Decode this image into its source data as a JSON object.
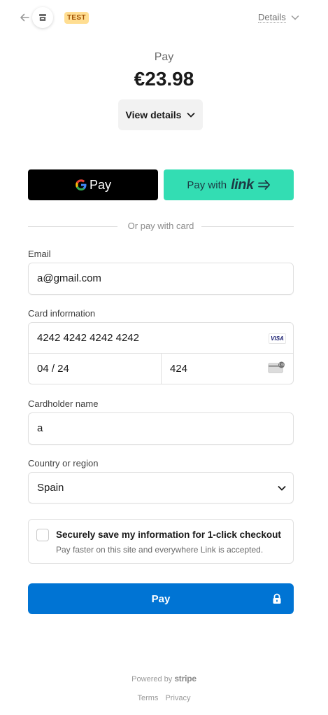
{
  "header": {
    "back_icon": "arrow-left-icon",
    "store_icon": "store-icon",
    "badge": "TEST",
    "details_link": "Details",
    "details_icon": "chevron-down-icon"
  },
  "summary": {
    "label": "Pay",
    "amount": "€23.98",
    "view_details": "View details"
  },
  "wallets": {
    "gpay_label": "Pay",
    "link_prefix": "Pay with",
    "link_word": "link"
  },
  "divider_text": "Or pay with card",
  "form": {
    "email_label": "Email",
    "email_value": "a@gmail.com",
    "card_label": "Card information",
    "card_number": "4242 4242 4242 4242",
    "card_brand": "VISA",
    "expiry": "04 / 24",
    "cvc": "424",
    "cvc_badge": "135",
    "name_label": "Cardholder name",
    "name_value": "a",
    "country_label": "Country or region",
    "country_value": "Spain"
  },
  "save": {
    "title": "Securely save my information for 1-click checkout",
    "subtitle": "Pay faster on this site and everywhere Link is accepted."
  },
  "pay_button": "Pay",
  "footer": {
    "powered_prefix": "Powered by",
    "powered_brand": "stripe",
    "links": [
      "Terms",
      "Privacy"
    ]
  },
  "colors": {
    "pay_button": "#0074d4",
    "link_button": "#33ddb3",
    "test_badge": "#ffde92"
  }
}
